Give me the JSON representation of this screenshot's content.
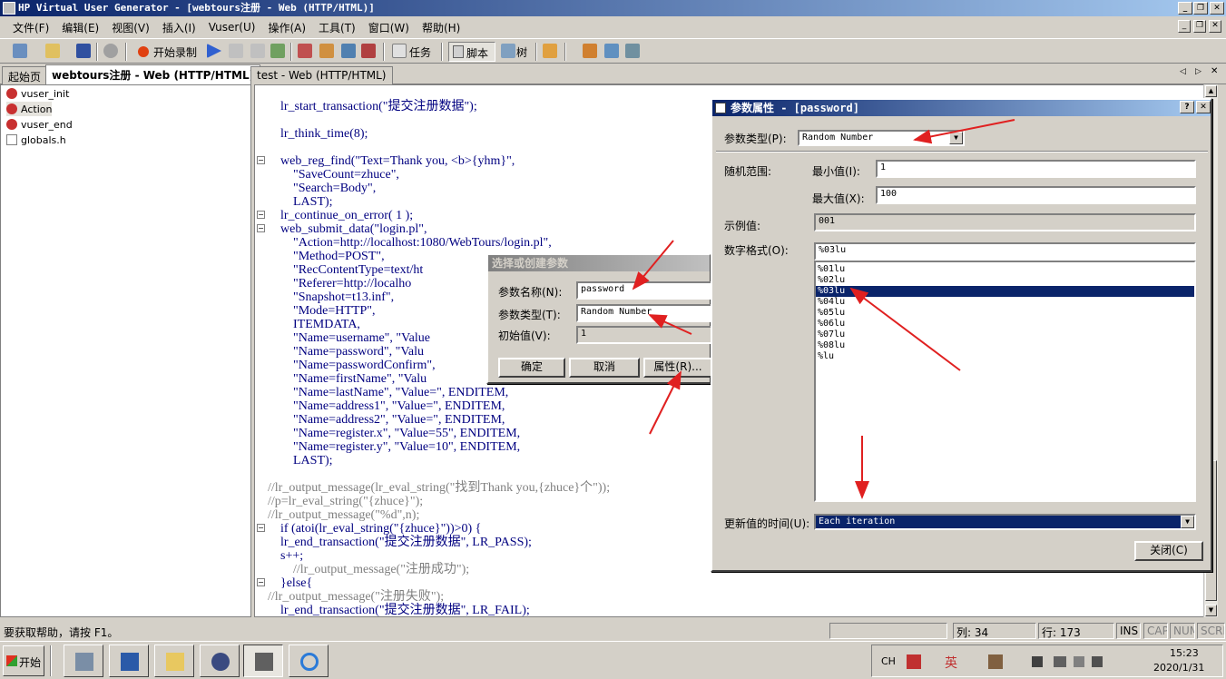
{
  "window": {
    "title": "HP Virtual User Generator - [webtours注册 - Web (HTTP/HTML)]"
  },
  "menu": [
    "文件(F)",
    "编辑(E)",
    "视图(V)",
    "插入(I)",
    "Vuser(U)",
    "操作(A)",
    "工具(T)",
    "窗口(W)",
    "帮助(H)"
  ],
  "toolbar": {
    "record": "开始录制",
    "task": "任务",
    "script": "脚本",
    "tree": "树"
  },
  "tabs": [
    "起始页",
    "webtours注册 - Web (HTTP/HTML)",
    "test - Web (HTTP/HTML)"
  ],
  "tree_items": [
    "vuser_init",
    "Action",
    "vuser_end",
    "globals.h"
  ],
  "code": [
    {
      "t": "    lr_start_transaction(\"提交注册数据\");",
      "c": 0
    },
    {
      "t": "    lr_think_time(8);",
      "c": 0
    },
    {
      "t": "    web_reg_find(\"Text=Thank you, <b>{yhm}\",",
      "c": 0
    },
    {
      "t": "        \"SaveCount=zhuce\",",
      "c": 0
    },
    {
      "t": "        \"Search=Body\",",
      "c": 0
    },
    {
      "t": "        LAST);",
      "c": 0
    },
    {
      "t": "    lr_continue_on_error( 1 );",
      "c": 0
    },
    {
      "t": "    web_submit_data(\"login.pl\",",
      "c": 0
    },
    {
      "t": "        \"Action=http://localhost:1080/WebTours/login.pl\",",
      "c": 0
    },
    {
      "t": "        \"Method=POST\",",
      "c": 0
    },
    {
      "t": "        \"RecContentType=text/ht",
      "c": 0
    },
    {
      "t": "        \"Referer=http://localho",
      "c": 0
    },
    {
      "t": "        \"Snapshot=t13.inf\",",
      "c": 0
    },
    {
      "t": "        \"Mode=HTTP\",",
      "c": 0
    },
    {
      "t": "        ITEMDATA,",
      "c": 0
    },
    {
      "t": "        \"Name=username\", \"Value",
      "c": 0
    },
    {
      "t": "        \"Name=password\", \"Valu",
      "c": 0
    },
    {
      "t": "        \"Name=passwordConfirm\",",
      "c": 0
    },
    {
      "t": "        \"Name=firstName\", \"Valu",
      "c": 0
    },
    {
      "t": "        \"Name=lastName\", \"Value=\", ENDITEM,",
      "c": 0
    },
    {
      "t": "        \"Name=address1\", \"Value=\", ENDITEM,",
      "c": 0
    },
    {
      "t": "        \"Name=address2\", \"Value=\", ENDITEM,",
      "c": 0
    },
    {
      "t": "        \"Name=register.x\", \"Value=55\", ENDITEM,",
      "c": 0
    },
    {
      "t": "        \"Name=register.y\", \"Value=10\", ENDITEM,",
      "c": 0
    },
    {
      "t": "        LAST);",
      "c": 0
    },
    {
      "t": "//lr_output_message(lr_eval_string(\"找到Thank you,{zhuce}个\"));",
      "c": 1
    },
    {
      "t": "//p=lr_eval_string(\"{zhuce}\");",
      "c": 1
    },
    {
      "t": "//lr_output_message(\"%d\",n);",
      "c": 1
    },
    {
      "t": "    if (atoi(lr_eval_string(\"{zhuce}\"))>0) {",
      "c": 0
    },
    {
      "t": "    lr_end_transaction(\"提交注册数据\", LR_PASS);",
      "c": 0
    },
    {
      "t": "    s++;",
      "c": 0
    },
    {
      "t": "        //lr_output_message(\"注册成功\");",
      "c": 1
    },
    {
      "t": "    }else{",
      "c": 0
    },
    {
      "t": "//lr_output_message(\"注册失败\");",
      "c": 1
    },
    {
      "t": "    lr_end_transaction(\"提交注册数据\", LR_FAIL);",
      "c": 0
    }
  ],
  "select_dialog": {
    "title": "选择或创建参数",
    "name_label": "参数名称(N):",
    "name_value": "password",
    "type_label": "参数类型(T):",
    "type_value": "Random Number",
    "init_label": "初始值(V):",
    "init_value": "1",
    "ok": "确定",
    "cancel": "取消",
    "props": "属性(R)..."
  },
  "prop_dialog": {
    "title": "参数属性 - [password]",
    "type_label": "参数类型(P):",
    "type_value": "Random Number",
    "range_label": "随机范围:",
    "min_label": "最小值(I):",
    "min_value": "1",
    "max_label": "最大值(X):",
    "max_value": "100",
    "sample_label": "示例值:",
    "sample_value": "001",
    "format_label": "数字格式(O):",
    "format_value": "%03lu",
    "formats": [
      "%01lu",
      "%02lu",
      "%03lu",
      "%04lu",
      "%05lu",
      "%06lu",
      "%07lu",
      "%08lu",
      "%lu"
    ],
    "selected_format": "%03lu",
    "update_label": "更新值的时间(U):",
    "update_value": "Each iteration",
    "close": "关闭(C)"
  },
  "status": {
    "help": "要获取帮助，请按 F1。",
    "col": "列: 34",
    "row": "行: 173",
    "ins": "INS",
    "cap": "CAP",
    "num": "NUM",
    "scrl": "SCRL"
  },
  "taskbar": {
    "start": "开始",
    "lang": "CH",
    "ime": "英",
    "time": "15:23",
    "date": "2020/1/31"
  },
  "colors": {
    "titlebar": "#0a246a",
    "selection": "#0a246a",
    "arrows": "#e02020",
    "code": "#000080",
    "comment": "#808080"
  }
}
